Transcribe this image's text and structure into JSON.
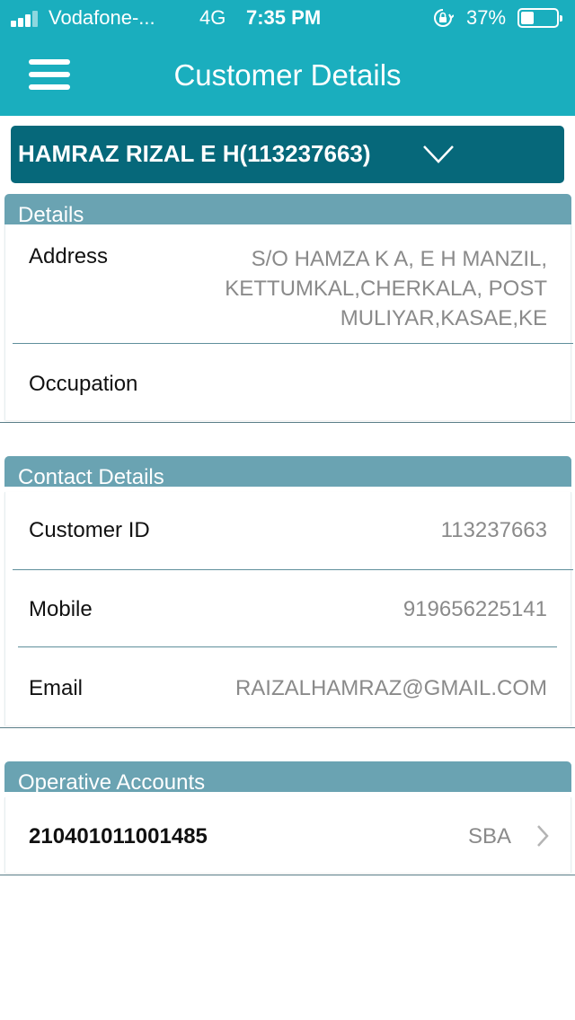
{
  "status_bar": {
    "carrier": "Vodafone-...",
    "network": "4G",
    "time": "7:35 PM",
    "battery_percent": "37%",
    "battery_level": 0.37,
    "icons": [
      "signal-icon",
      "orientation-lock-icon",
      "battery-icon"
    ]
  },
  "header": {
    "title": "Customer Details",
    "menu_icon": "hamburger-menu-icon"
  },
  "customer_select": {
    "selected": "HAMRAZ RIZAL E H(113237663)",
    "icon": "chevron-down-icon"
  },
  "details": {
    "title": "Details",
    "rows": [
      {
        "label": "Address",
        "value_lines": [
          "S/O HAMZA K A, E H MANZIL,",
          "KETTUMKAL,CHERKALA, POST",
          "MULIYAR,KASAE,KE"
        ]
      },
      {
        "label": "Occupation",
        "value": ""
      }
    ]
  },
  "contact": {
    "title": "Contact Details",
    "rows": [
      {
        "label": "Customer ID",
        "value": "113237663"
      },
      {
        "label": "Mobile",
        "value": "919656225141"
      },
      {
        "label": "Email",
        "value": "RAIZALHAMRAZ@GMAIL.COM"
      }
    ]
  },
  "accounts": {
    "title": "Operative Accounts",
    "items": [
      {
        "number": "210401011001485",
        "type": "SBA",
        "icon": "chevron-right-icon"
      }
    ]
  }
}
